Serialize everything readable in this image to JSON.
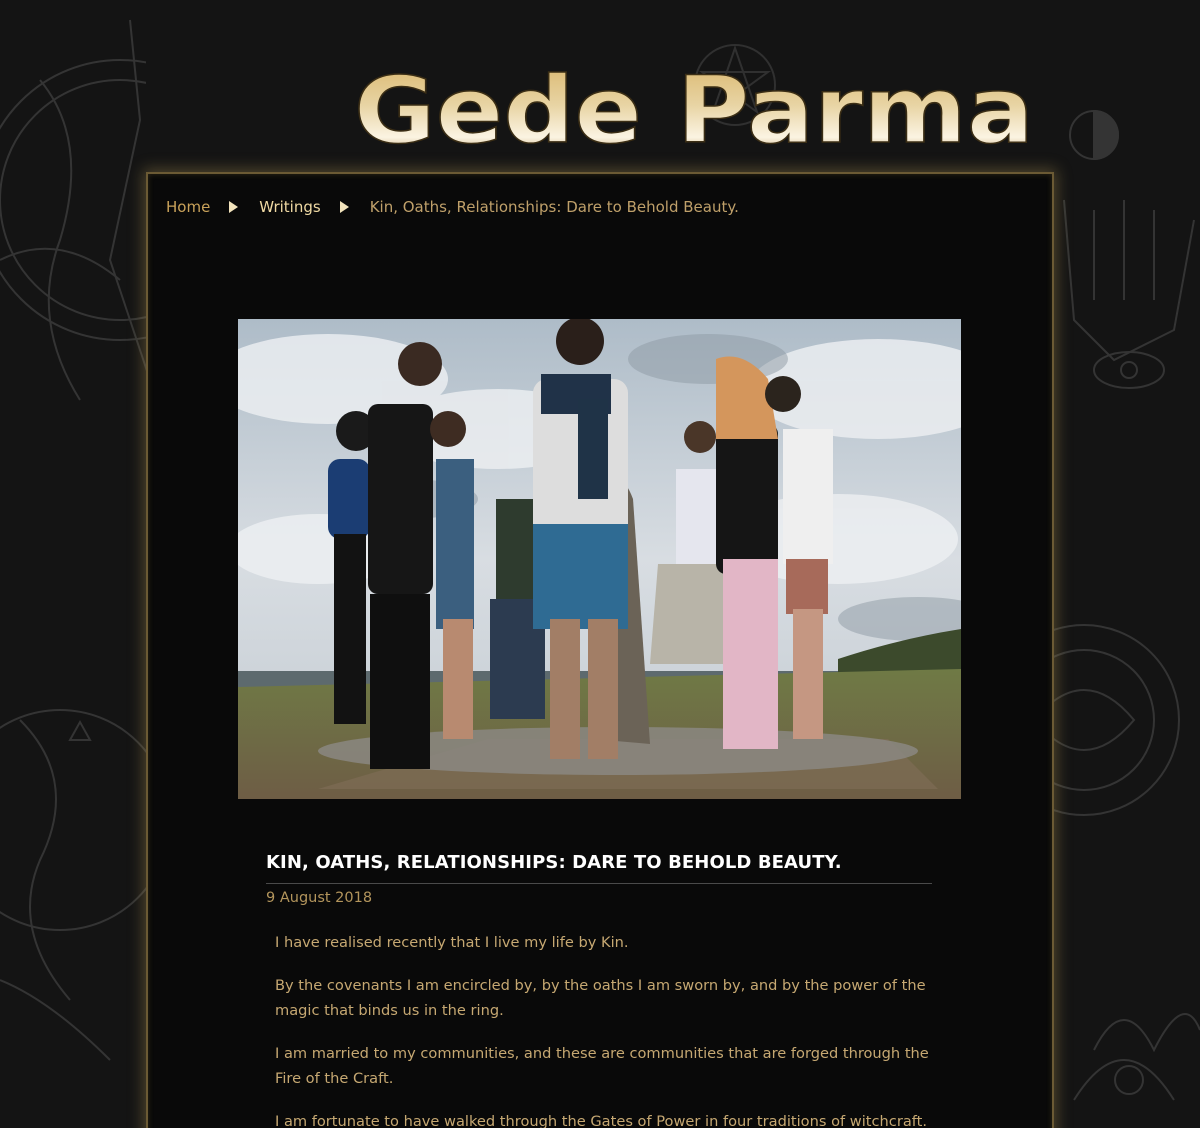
{
  "site": {
    "title": "Gede Parma"
  },
  "breadcrumb": {
    "home": "Home",
    "writings": "Writings",
    "current": "Kin, Oaths, Relationships: Dare to Behold Beauty."
  },
  "hero": {
    "alt": "Group of people holding hands in a circle around a standing stone on a hilltop"
  },
  "post": {
    "title": "KIN, OATHS, RELATIONSHIPS: DARE TO BEHOLD BEAUTY.",
    "date": "9 August 2018",
    "paragraphs": [
      "I have realised recently that I live my life by Kin.",
      "By the covenants I am encircled by, by the oaths I am sworn by, and by the power of the magic that binds us in the ring.",
      "I am married to my communities, and these are communities that are forged through the Fire of the Craft.",
      "I am fortunate to have walked through the Gates of Power in four traditions of witchcraft. They"
    ]
  },
  "colors": {
    "accent_gold": "#c9a25a",
    "body_text": "#c6a872",
    "page_bg": "#141414",
    "panel_bg": "#090909"
  },
  "icons": {
    "breadcrumb_separator": "triangle-right-icon"
  }
}
